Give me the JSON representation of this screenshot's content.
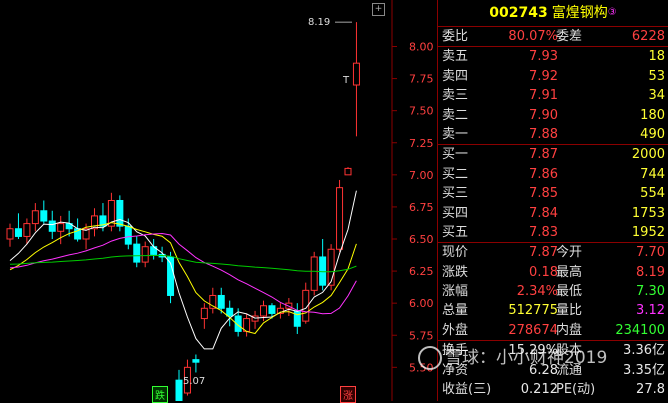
{
  "stock": {
    "code": "002743",
    "name": "富煌钢构",
    "mark": "③"
  },
  "rows": [
    {
      "l1": "委比",
      "v1": "80.07%",
      "c1": "red",
      "l2": "委差",
      "v2": "6228",
      "c2": "red"
    },
    {
      "l1": "卖五",
      "v1": "7.93",
      "c1": "red",
      "v2": "18",
      "c2": "yel"
    },
    {
      "l1": "卖四",
      "v1": "7.92",
      "c1": "red",
      "v2": "53",
      "c2": "yel"
    },
    {
      "l1": "卖三",
      "v1": "7.91",
      "c1": "red",
      "v2": "34",
      "c2": "yel"
    },
    {
      "l1": "卖二",
      "v1": "7.90",
      "c1": "red",
      "v2": "180",
      "c2": "yel"
    },
    {
      "l1": "卖一",
      "v1": "7.88",
      "c1": "red",
      "v2": "490",
      "c2": "yel"
    },
    {
      "l1": "买一",
      "v1": "7.87",
      "c1": "red",
      "v2": "2000",
      "c2": "yel"
    },
    {
      "l1": "买二",
      "v1": "7.86",
      "c1": "red",
      "v2": "744",
      "c2": "yel"
    },
    {
      "l1": "买三",
      "v1": "7.85",
      "c1": "red",
      "v2": "554",
      "c2": "yel"
    },
    {
      "l1": "买四",
      "v1": "7.84",
      "c1": "red",
      "v2": "1753",
      "c2": "yel"
    },
    {
      "l1": "买五",
      "v1": "7.83",
      "c1": "red",
      "v2": "1952",
      "c2": "yel"
    },
    {
      "l1": "现价",
      "v1": "7.87",
      "c1": "red",
      "l2": "今开",
      "v2": "7.70",
      "c2": "red"
    },
    {
      "l1": "涨跌",
      "v1": "0.18",
      "c1": "red",
      "l2": "最高",
      "v2": "8.19",
      "c2": "red"
    },
    {
      "l1": "涨幅",
      "v1": "2.34%",
      "c1": "red",
      "l2": "最低",
      "v2": "7.30",
      "c2": "grn"
    },
    {
      "l1": "总量",
      "v1": "512775",
      "c1": "yel",
      "l2": "量比",
      "v2": "3.12",
      "c2": "mag"
    },
    {
      "l1": "外盘",
      "v1": "278674",
      "c1": "red",
      "l2": "内盘",
      "v2": "234100",
      "c2": "grn"
    },
    {
      "l1": "换手",
      "v1": "15.29%",
      "c1": "wht",
      "l2": "股本",
      "v2": "3.36亿",
      "c2": "wht"
    },
    {
      "l1": "净资",
      "v1": "6.28",
      "c1": "wht",
      "l2": "流通",
      "v2": "3.35亿",
      "c2": "wht"
    },
    {
      "l1": "收益(三)",
      "v1": "0.212",
      "c1": "wht",
      "l2": "PE(动)",
      "v2": "27.8",
      "c2": "wht"
    }
  ],
  "chart": {
    "high_label": "8.19",
    "low_label": "5.07",
    "tag_die": "跌",
    "tag_zhang": "涨",
    "t_label": "T",
    "watermark": "雪球：小小财神2019",
    "colors": {
      "up": "#ff3333",
      "down": "#00ffff",
      "ma5": "#ffffff",
      "ma10": "#ffff00",
      "ma20": "#ff33ff",
      "ma60": "#00cc00"
    }
  },
  "chart_data": {
    "type": "candlestick",
    "y_ticks": [
      "8.00",
      "7.75",
      "7.50",
      "7.25",
      "7.00",
      "6.75",
      "6.50",
      "6.25",
      "6.00",
      "5.75",
      "5.50"
    ],
    "ylim": [
      5.3,
      8.3
    ],
    "candles": [
      [
        6.5,
        6.62,
        6.44,
        6.58
      ],
      [
        6.58,
        6.7,
        6.5,
        6.52
      ],
      [
        6.52,
        6.66,
        6.46,
        6.62
      ],
      [
        6.62,
        6.78,
        6.56,
        6.72
      ],
      [
        6.72,
        6.8,
        6.62,
        6.64
      ],
      [
        6.64,
        6.72,
        6.5,
        6.56
      ],
      [
        6.56,
        6.68,
        6.46,
        6.62
      ],
      [
        6.62,
        6.72,
        6.52,
        6.58
      ],
      [
        6.58,
        6.66,
        6.48,
        6.5
      ],
      [
        6.5,
        6.62,
        6.42,
        6.58
      ],
      [
        6.58,
        6.74,
        6.52,
        6.68
      ],
      [
        6.68,
        6.78,
        6.56,
        6.6
      ],
      [
        6.6,
        6.86,
        6.56,
        6.8
      ],
      [
        6.8,
        6.84,
        6.56,
        6.6
      ],
      [
        6.6,
        6.66,
        6.42,
        6.46
      ],
      [
        6.46,
        6.52,
        6.28,
        6.32
      ],
      [
        6.32,
        6.48,
        6.28,
        6.44
      ],
      [
        6.44,
        6.5,
        6.34,
        6.38
      ],
      [
        6.38,
        6.44,
        6.32,
        6.36
      ],
      [
        6.36,
        6.4,
        6.0,
        6.06
      ],
      [
        5.4,
        5.48,
        5.07,
        5.16
      ],
      [
        5.3,
        5.56,
        5.28,
        5.5
      ],
      [
        5.56,
        5.6,
        5.46,
        5.54
      ],
      [
        5.88,
        6.0,
        5.8,
        5.96
      ],
      [
        5.96,
        6.12,
        5.92,
        6.06
      ],
      [
        6.06,
        6.12,
        5.92,
        5.96
      ],
      [
        5.96,
        6.02,
        5.82,
        5.9
      ],
      [
        5.9,
        5.96,
        5.74,
        5.78
      ],
      [
        5.78,
        5.92,
        5.74,
        5.88
      ],
      [
        5.86,
        5.94,
        5.8,
        5.9
      ],
      [
        5.9,
        6.02,
        5.86,
        5.98
      ],
      [
        5.98,
        6.0,
        5.88,
        5.92
      ],
      [
        5.92,
        6.0,
        5.88,
        5.96
      ],
      [
        5.96,
        6.04,
        5.9,
        6.0
      ],
      [
        5.94,
        6.0,
        5.76,
        5.82
      ],
      [
        5.86,
        6.16,
        5.84,
        6.1
      ],
      [
        6.1,
        6.4,
        6.06,
        6.36
      ],
      [
        6.36,
        6.5,
        6.1,
        6.14
      ],
      [
        6.14,
        6.46,
        6.1,
        6.42
      ],
      [
        6.42,
        6.96,
        6.4,
        6.9
      ],
      [
        7.0,
        7.06,
        7.0,
        7.05
      ],
      [
        7.7,
        8.19,
        7.3,
        7.87
      ]
    ]
  }
}
